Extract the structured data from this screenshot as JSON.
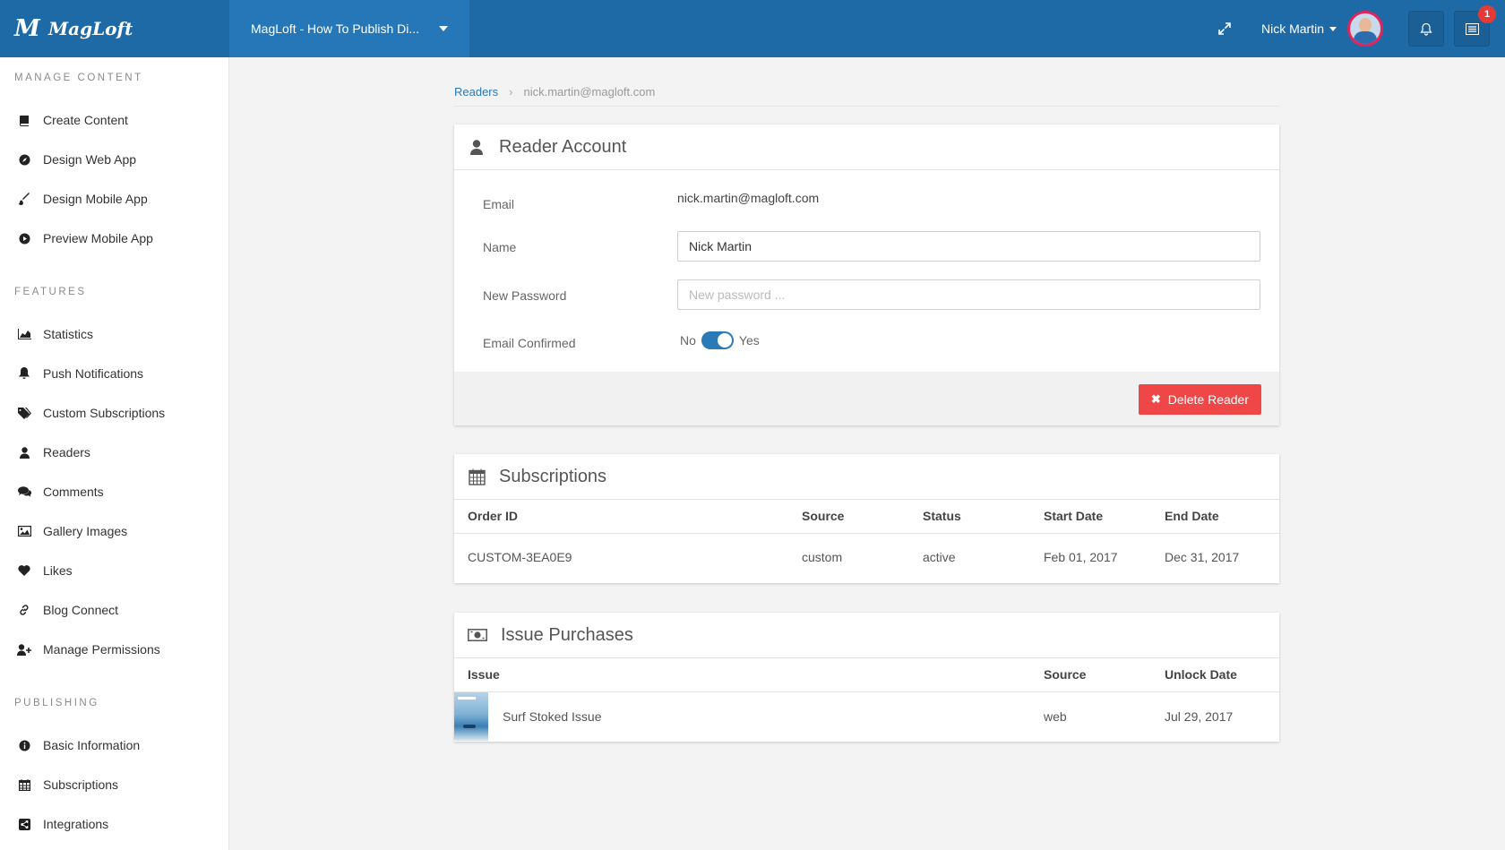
{
  "app": {
    "brand_name": "MagLoft",
    "project_name": "MagLoft - How To Publish Di...",
    "user_name": "Nick Martin",
    "notification_count": "1",
    "accent_color": "#1e6aa7"
  },
  "sidebar": {
    "sections": [
      {
        "heading": "MANAGE CONTENT",
        "items": [
          {
            "label": "Create Content",
            "icon": "book-icon"
          },
          {
            "label": "Design Web App",
            "icon": "compass-icon"
          },
          {
            "label": "Design Mobile App",
            "icon": "brush-icon"
          },
          {
            "label": "Preview Mobile App",
            "icon": "play-circle-icon"
          }
        ]
      },
      {
        "heading": "FEATURES",
        "items": [
          {
            "label": "Statistics",
            "icon": "area-chart-icon"
          },
          {
            "label": "Push Notifications",
            "icon": "bell-icon"
          },
          {
            "label": "Custom Subscriptions",
            "icon": "tags-icon"
          },
          {
            "label": "Readers",
            "icon": "user-icon"
          },
          {
            "label": "Comments",
            "icon": "comments-icon"
          },
          {
            "label": "Gallery Images",
            "icon": "image-icon"
          },
          {
            "label": "Likes",
            "icon": "heart-icon"
          },
          {
            "label": "Blog Connect",
            "icon": "link-icon"
          },
          {
            "label": "Manage Permissions",
            "icon": "user-plus-icon"
          }
        ]
      },
      {
        "heading": "PUBLISHING",
        "items": [
          {
            "label": "Basic Information",
            "icon": "info-circle-icon"
          },
          {
            "label": "Subscriptions",
            "icon": "calendar-icon"
          },
          {
            "label": "Integrations",
            "icon": "share-icon"
          }
        ]
      }
    ]
  },
  "breadcrumb": {
    "parent": "Readers",
    "current": "nick.martin@magloft.com"
  },
  "reader_account": {
    "title": "Reader Account",
    "email_label": "Email",
    "email_value": "nick.martin@magloft.com",
    "name_label": "Name",
    "name_value": "Nick Martin",
    "password_label": "New Password",
    "password_placeholder": "New password ...",
    "confirmed_label": "Email Confirmed",
    "toggle_off": "No",
    "toggle_on": "Yes",
    "confirmed": true,
    "delete_label": "Delete Reader"
  },
  "subscriptions": {
    "title": "Subscriptions",
    "columns": [
      "Order ID",
      "Source",
      "Status",
      "Start Date",
      "End Date"
    ],
    "rows": [
      {
        "order_id": "CUSTOM-3EA0E9",
        "source": "custom",
        "status": "active",
        "start_date": "Feb 01, 2017",
        "end_date": "Dec 31, 2017"
      }
    ]
  },
  "issue_purchases": {
    "title": "Issue Purchases",
    "columns": [
      "Issue",
      "Source",
      "Unlock Date"
    ],
    "rows": [
      {
        "issue": "Surf Stoked Issue",
        "source": "web",
        "unlock_date": "Jul 29, 2017"
      }
    ]
  }
}
